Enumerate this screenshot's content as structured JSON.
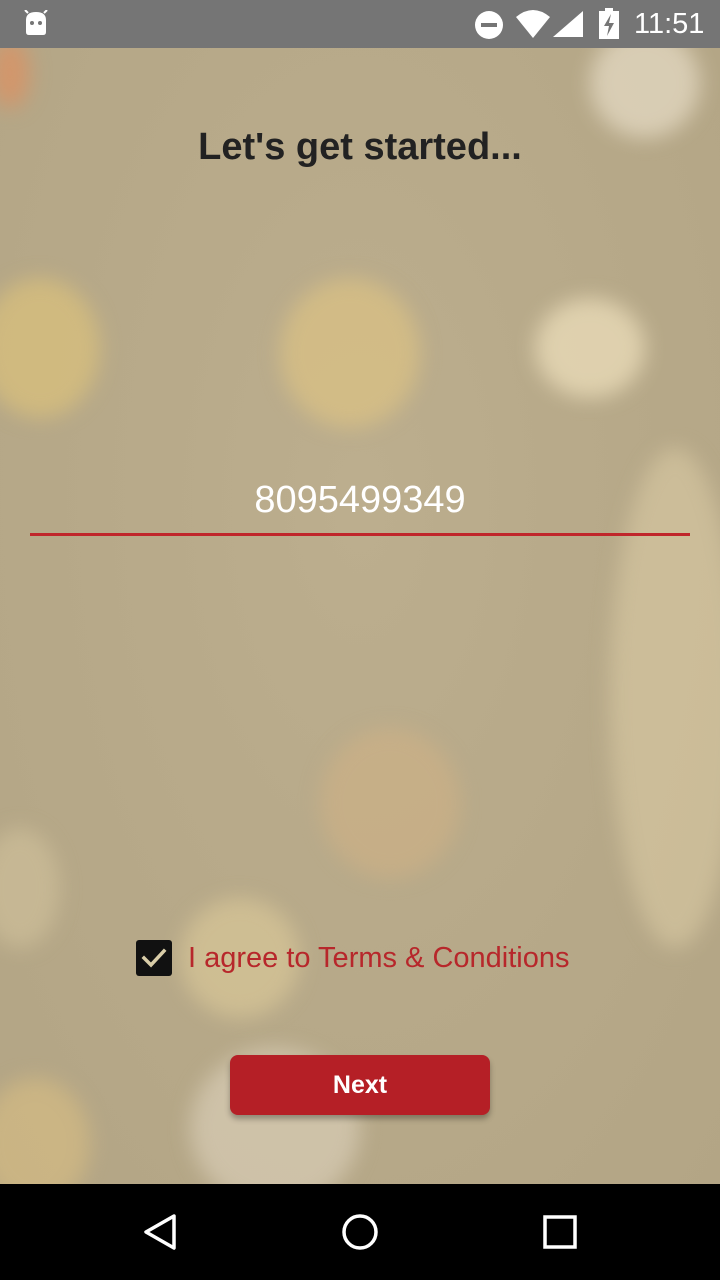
{
  "status_bar": {
    "time": "11:51",
    "icons": [
      "android-icon",
      "dnd-icon",
      "wifi-icon",
      "signal-icon",
      "battery-charging-icon"
    ]
  },
  "main": {
    "title": "Let's get started...",
    "phone_input": {
      "value": "8095499349",
      "placeholder": ""
    },
    "terms_checkbox": {
      "checked": true,
      "label": "I agree to Terms & Conditions"
    },
    "next_button": {
      "label": "Next"
    }
  },
  "colors": {
    "accent": "#b51f26",
    "background": "#b8aa8a",
    "status_bar": "#757575"
  },
  "nav_bar": {
    "icons": [
      "back-icon",
      "home-icon",
      "recents-icon"
    ]
  }
}
